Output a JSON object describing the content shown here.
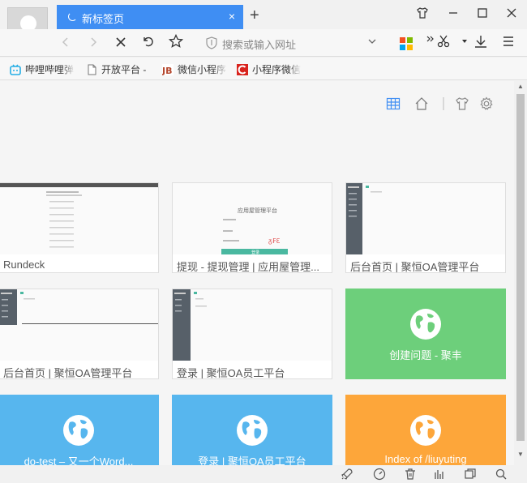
{
  "tab": {
    "title": "新标签页",
    "close": "×"
  },
  "new_tab": "+",
  "address_bar": {
    "placeholder": "搜索或输入网址"
  },
  "bookmarks": [
    {
      "label": "哔哩哔哩弹",
      "icon": "bilibili-icon"
    },
    {
      "label": "开放平台 -",
      "icon": "page-icon"
    },
    {
      "label": "微信小程序",
      "icon": "jb-icon"
    },
    {
      "label": "小程序微信",
      "icon": "c-icon"
    }
  ],
  "tiles": [
    {
      "caption": "Rundeck"
    },
    {
      "caption": "提现 - 提现管理 | 应用屋管理..."
    },
    {
      "caption": "后台首页 | 聚恒OA管理平台"
    },
    {
      "caption": "后台首页 | 聚恒OA管理平台"
    },
    {
      "caption": "登录 | 聚恒OA员工平台"
    }
  ],
  "thumb_text": {
    "app_platform": "应用屋管理平台",
    "login_btn": "登录"
  },
  "color_tiles": [
    {
      "title": "创建问题 - 聚丰",
      "color": "#6dcf7b"
    },
    {
      "title": "do-test – 又一个Word...",
      "color": "#57b6ee"
    },
    {
      "title": "登录 | 聚恒OA员工平台",
      "color": "#57b6ee"
    },
    {
      "title": "Index of /liuyuting",
      "color": "#fda63a"
    }
  ],
  "colors": {
    "tab_active": "#3f8ef3",
    "accent_green": "#4ab8a0"
  }
}
